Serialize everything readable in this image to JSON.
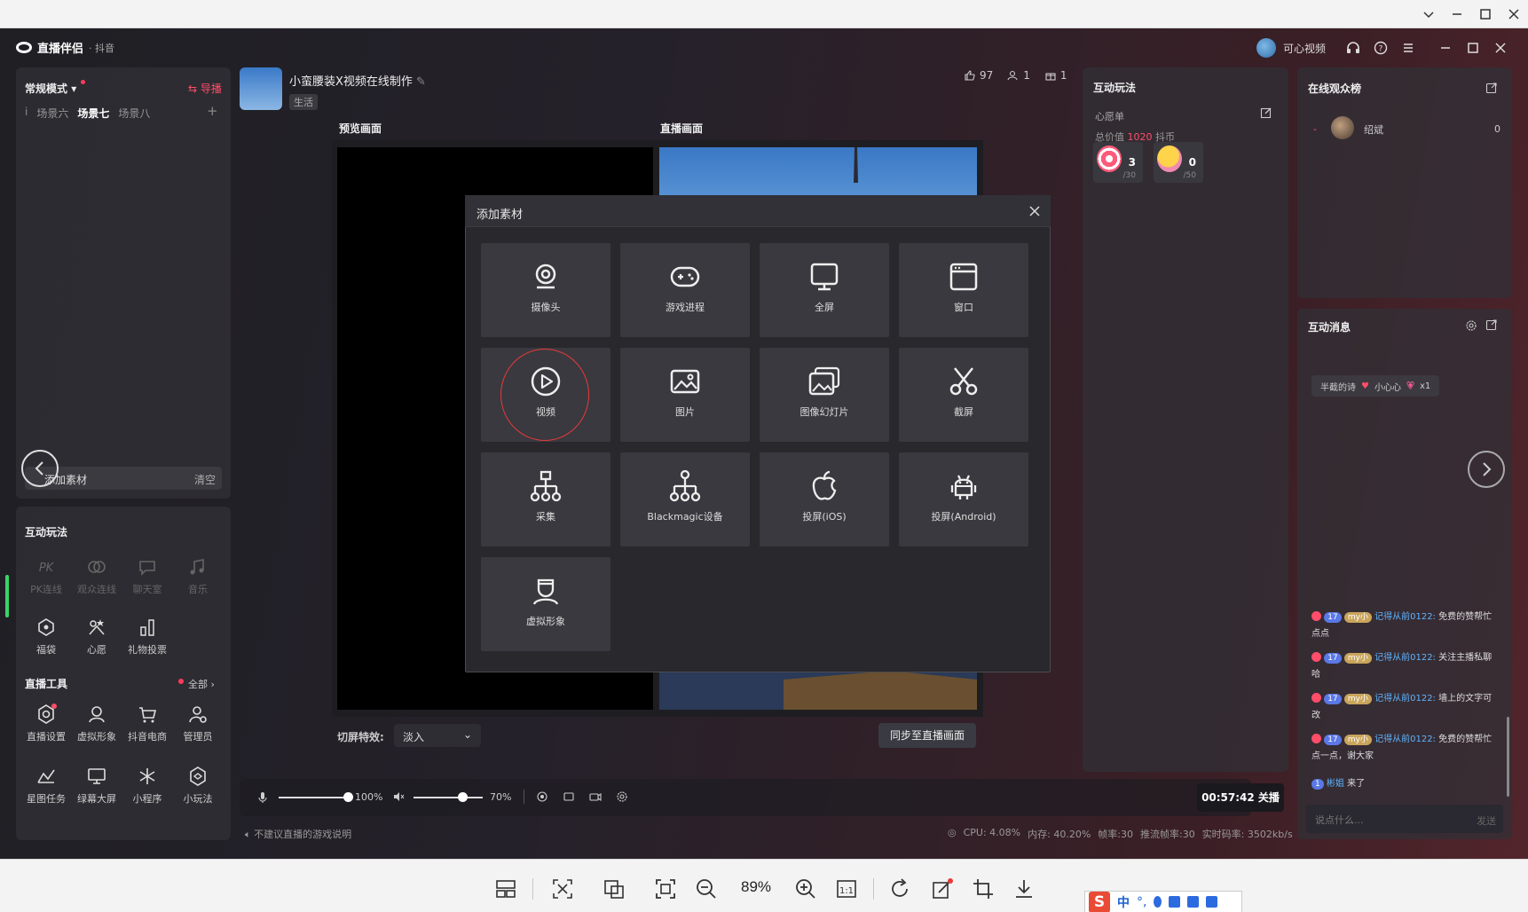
{
  "viewer": {
    "zoom": "89%",
    "toolbar_icons": [
      "layout-icon",
      "fit-icon",
      "compare-icon",
      "fullscreen-icon",
      "zoom-out-icon",
      "zoom-in-icon",
      "actual-size-icon",
      "rotate-icon",
      "edit-icon",
      "crop-icon",
      "download-icon"
    ]
  },
  "ime": {
    "logo": "S",
    "lang": "中"
  },
  "app": {
    "title": "直播伴侣",
    "platform": "· 抖音",
    "user_name": "可心视频"
  },
  "left": {
    "mode": "常规模式",
    "guide": "⇆ 导播",
    "scenes": [
      "场景六",
      "场景七",
      "场景八"
    ],
    "active_scene": "场景七",
    "add_material": "添加素材",
    "clear": "清空",
    "interact_title": "互动玩法",
    "interact_tools": [
      {
        "label": "PK连线",
        "enabled": false
      },
      {
        "label": "观众连线",
        "enabled": false
      },
      {
        "label": "聊天室",
        "enabled": false
      },
      {
        "label": "音乐",
        "enabled": false
      },
      {
        "label": "福袋",
        "enabled": true
      },
      {
        "label": "心愿",
        "enabled": true
      },
      {
        "label": "礼物投票",
        "enabled": true
      }
    ],
    "live_tools_title": "直播工具",
    "all_label": "全部 ›",
    "live_tools": [
      "直播设置",
      "虚拟形象",
      "抖音电商",
      "管理员",
      "星图任务",
      "绿幕大屏",
      "小程序",
      "小玩法"
    ]
  },
  "room": {
    "title": "小蛮腰装X视频在线制作",
    "tag": "生活",
    "likes": "97",
    "viewers": "1",
    "gifts": "1"
  },
  "center": {
    "preview_label": "预览画面",
    "live_label": "直播画面",
    "transition_label": "切屏特效:",
    "transition_value": "淡入",
    "sync_button": "同步至直播画面",
    "mic_pct": "100%",
    "speaker_pct": "70%",
    "mic_level": 1.0,
    "speaker_level": 0.7,
    "timer": "00:57:42 关播",
    "hint": "不建议直播的游戏说明",
    "stats": [
      "CPU: 4.08%",
      "内存: 40.20%",
      "帧率:30",
      "推流帧率:30",
      "实时码率: 3502kb/s"
    ]
  },
  "wish": {
    "title": "互动玩法",
    "sub": "心愿单",
    "total_prefix": "总价值",
    "total_value": "1020",
    "total_suffix": "抖币",
    "gifts": [
      {
        "count": "3",
        "max": "/30"
      },
      {
        "count": "0",
        "max": "/50"
      }
    ]
  },
  "audience": {
    "title": "在线观众榜",
    "rank": "-",
    "name": "绍斌",
    "score": "0"
  },
  "messages": {
    "title": "互动消息",
    "gift_msg_user": "半截的诗",
    "gift_msg_gift": "小心心",
    "gift_msg_count": "x1",
    "chats": [
      {
        "lv": "17",
        "fan": "my小",
        "who": "记得从前0122:",
        "text": "免费的赞帮忙点点"
      },
      {
        "lv": "17",
        "fan": "my小",
        "who": "记得从前0122:",
        "text": "关注主播私聊哈"
      },
      {
        "lv": "17",
        "fan": "my小",
        "who": "记得从前0122:",
        "text": "墙上的文字可改"
      },
      {
        "lv": "17",
        "fan": "my小",
        "who": "记得从前0122:",
        "text": "免费的赞帮忙点一点，谢大家"
      }
    ],
    "join": {
      "lv": "1",
      "who": "彬姐",
      "text": "来了"
    },
    "input_placeholder": "说点什么...",
    "send": "发送"
  },
  "modal": {
    "title": "添加素材",
    "tiles": [
      "摄像头",
      "游戏进程",
      "全屏",
      "窗口",
      "视频",
      "图片",
      "图像幻灯片",
      "截屏",
      "采集",
      "Blackmagic设备",
      "投屏(iOS)",
      "投屏(Android)",
      "虚拟形象"
    ]
  },
  "colors": {
    "accent": "#ff4d6a",
    "highlight_circle": "#e83a3a",
    "link": "#5eb4ff"
  }
}
